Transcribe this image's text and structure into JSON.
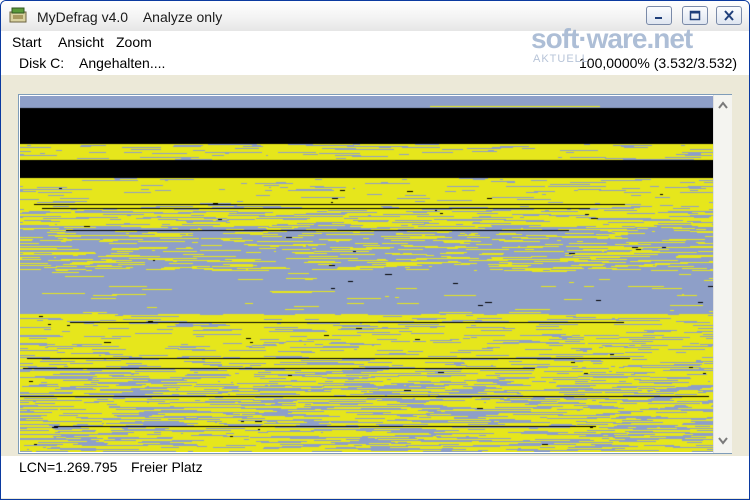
{
  "window": {
    "title": "MyDefrag v4.0    Analyze only"
  },
  "menu": {
    "items": [
      {
        "label": "Start"
      },
      {
        "label": "Ansicht"
      },
      {
        "label": "Zoom"
      }
    ]
  },
  "status": {
    "disk": "Disk C:",
    "state": "Angehalten....",
    "progress": "100,0000% (3.532/3.532)"
  },
  "footer": {
    "lcn": "LCN=1.269.795",
    "legend": "Freier Platz"
  },
  "watermark": {
    "main": "soft·ware.net",
    "sub": "AKTUELL"
  },
  "colors": {
    "used": "#e6e61c",
    "free": "#8e9fc8",
    "metadata": "#000000",
    "title_bg": "#f2f2f2"
  },
  "icons": {
    "app": "mydefrag-app-icon",
    "minimize": "minimize-icon",
    "maximize": "maximize-icon",
    "close": "close-icon",
    "scroll_up": "arrow-up-icon",
    "scroll_down": "arrow-down-icon"
  }
}
